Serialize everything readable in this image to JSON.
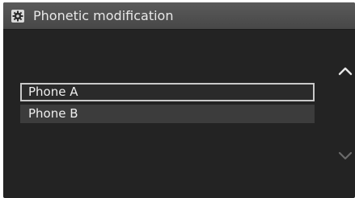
{
  "titlebar": {
    "icon": "gear-icon",
    "title": "Phonetic modification"
  },
  "list": {
    "items": [
      {
        "label": "Phone A",
        "selected": true
      },
      {
        "label": "Phone B",
        "selected": false
      }
    ]
  },
  "scroll": {
    "up_icon": "chevron-up-icon",
    "down_icon": "chevron-down-icon",
    "up_color": "#e6e6e6",
    "down_color": "#6a6a6a"
  },
  "colors": {
    "background": "#232323",
    "titlebar": "#4f4f4f",
    "item": "#3c3c3c",
    "selected_border": "#c9c9c9"
  }
}
